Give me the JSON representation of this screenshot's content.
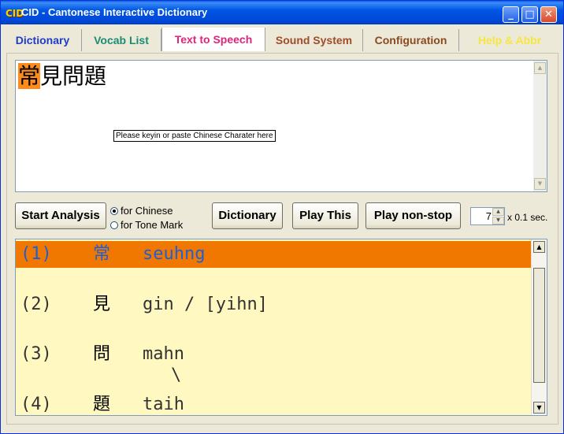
{
  "window": {
    "title": "CID - Cantonese Interactive Dictionary",
    "app_icon": "CID"
  },
  "titlebar_buttons": {
    "minimize": "_",
    "maximize": "□",
    "close": "✕"
  },
  "tabs": [
    {
      "label": "Dictionary"
    },
    {
      "label": "Vocab List"
    },
    {
      "label": "Text to Speech"
    },
    {
      "label": "Sound System"
    },
    {
      "label": "Configuration"
    },
    {
      "label": "Help & Abbr"
    }
  ],
  "input": {
    "highlighted_char": "常",
    "rest_text": "見問題",
    "tooltip": "Please keyin or paste Chinese Charater here"
  },
  "controls": {
    "start_analysis": "Start Analysis",
    "radio_chinese": "for Chinese",
    "radio_tone": "for Tone Mark",
    "dictionary": "Dictionary",
    "play_this": "Play This",
    "play_nonstop": "Play non-stop",
    "interval_value": "7",
    "interval_unit": "x 0.1 sec."
  },
  "results": [
    {
      "num": "(1)",
      "char": "常",
      "romanization": "seuhng"
    },
    {
      "num": "(2)",
      "char": "見",
      "romanization": "gin / [yihn]"
    },
    {
      "num": "(3)",
      "char": "問",
      "romanization": "mahn"
    },
    {
      "num": "(4)",
      "char": "題",
      "romanization": "taih"
    }
  ],
  "tone_mark": "\\",
  "colors": {
    "highlight": "#f07800",
    "result_bg": "#fff8c0",
    "tab_active_text": "#e0247b"
  }
}
